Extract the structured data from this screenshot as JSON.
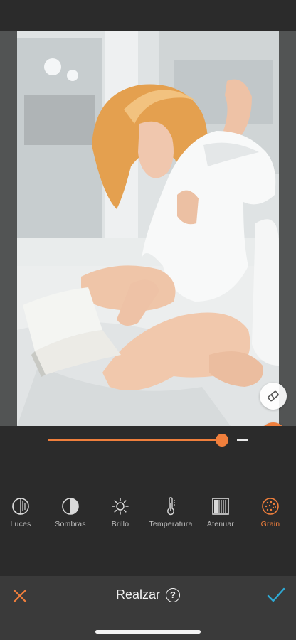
{
  "editor": {
    "slider_value_percent": 87
  },
  "tools": [
    {
      "label": "Luces",
      "icon": "lights-icon",
      "active": false
    },
    {
      "label": "Sombras",
      "icon": "shadows-icon",
      "active": false
    },
    {
      "label": "Brillo",
      "icon": "brightness-sun-icon",
      "active": false
    },
    {
      "label": "Temperatura",
      "icon": "thermometer-icon",
      "active": false
    },
    {
      "label": "Atenuar",
      "icon": "fade-icon",
      "active": false
    },
    {
      "label": "Grain",
      "icon": "grain-icon",
      "active": true
    }
  ],
  "bottom_bar": {
    "title": "Realzar",
    "help_icon": "help-icon",
    "cancel_icon": "close-icon",
    "confirm_icon": "checkmark-icon"
  },
  "colors": {
    "accent": "#f07f3c",
    "confirm": "#2ea9d4",
    "background": "#2b2b2b",
    "bottom_bar": "#3a3a3a"
  }
}
